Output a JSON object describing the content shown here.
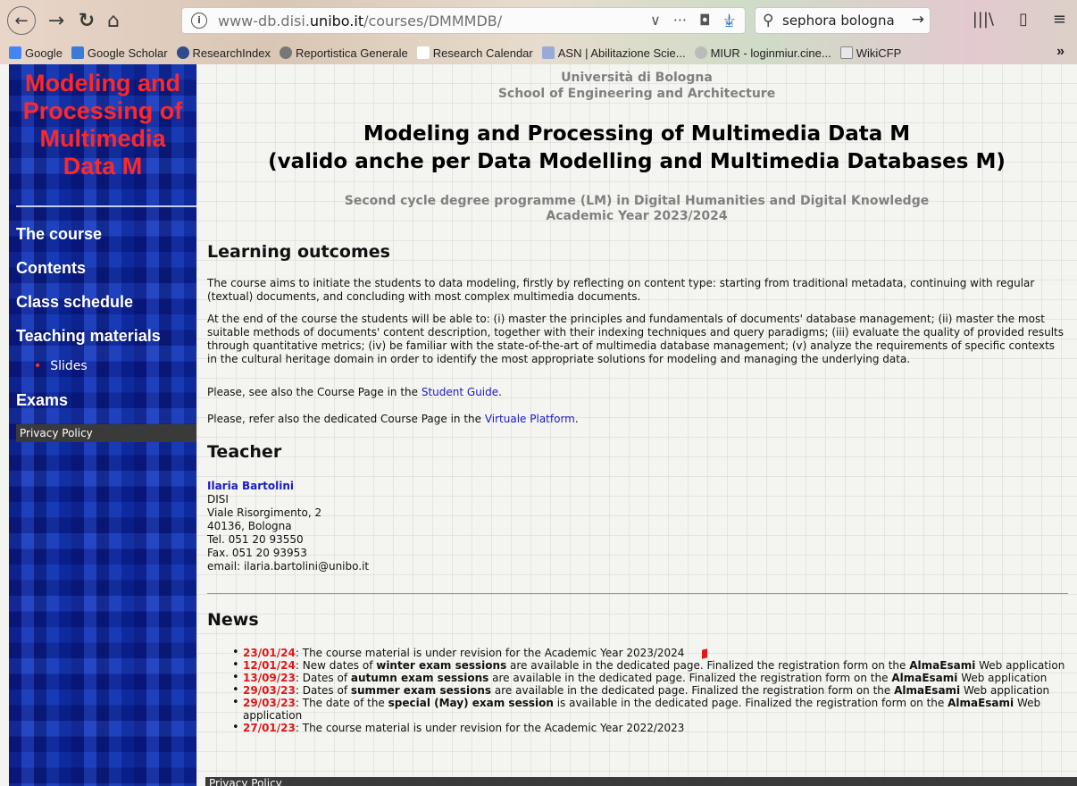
{
  "browser": {
    "url_prefix": "www-db.disi.",
    "url_host": "unibo.it",
    "url_path": "/courses/DMMMDB/",
    "search_query": "sephora bologna f",
    "bookmarks": [
      "Google",
      "Google Scholar",
      "ResearchIndex",
      "Reportistica Generale",
      "Research Calendar",
      "ASN | Abilitazione Scie...",
      "MIUR - loginmiur.cine...",
      "WikiCFP"
    ],
    "bookmark_more": "»"
  },
  "sidebar": {
    "title_lines": [
      "Modeling and",
      "Processing of",
      "Multimedia",
      "Data M"
    ],
    "items": [
      "The course",
      "Contents",
      "Class schedule",
      "Teaching materials",
      "Exams"
    ],
    "subitem": "Slides",
    "privacy": "Privacy Policy"
  },
  "main": {
    "university": "Università di Bologna",
    "school": "School of Engineering and Architecture",
    "title_line1": "Modeling and Processing of Multimedia Data M",
    "title_line2": "(valido anche per Data Modelling and Multimedia Databases M)",
    "programme": "Second cycle degree programme (LM) in Digital Humanities and Digital Knowledge",
    "year": "Academic Year 2023/2024",
    "h_outcomes": "Learning outcomes",
    "outcomes_p1": "The course aims to initiate the students to data modeling, firstly by reflecting on content type: starting from traditional metadata, continuing with regular (textual) documents, and concluding with most complex multimedia documents.",
    "outcomes_p2": "At the end of the course the students will be able to: (i) master the principles and fundamentals of documents' database management; (ii) master the most suitable methods of documents' content description, together with their indexing techniques and query paradigms; (iii) evaluate the quality of provided results through quantitative metrics; (iv) be familiar with the state-of-the-art of multimedia database management; (v) analyze the requirements of specific contexts in the cultural heritage domain in order to identify the most appropriate solutions for modeling and managing the underlying data.",
    "guide_pre": "Please, see also the Course Page in the ",
    "guide_link": "Student Guide",
    "guide_post": ".",
    "platform_pre": "Please, refer also the dedicated Course Page in the ",
    "platform_link": "Virtuale Platform",
    "platform_post": ".",
    "h_teacher": "Teacher",
    "teacher_name": "Ilaria Bartolini",
    "teacher_lines": [
      "DISI",
      "Viale Risorgimento, 2",
      "40136, Bologna",
      "Tel. 051 20 93550",
      "Fax. 051 20 93953",
      "email: ilaria.bartolini@unibo.it"
    ],
    "h_news": "News",
    "footer": "Privacy Policy"
  },
  "news": [
    {
      "date": "23/01/24",
      "parts": [
        ": The course material is under revision for the Academic Year 2023/2024"
      ],
      "flag": true
    },
    {
      "date": "12/01/24",
      "parts": [
        ": New dates of ",
        "winter exam sessions",
        " are available in the dedicated page. Finalized the registration form on the ",
        "AlmaEsami",
        " Web application"
      ]
    },
    {
      "date": "13/09/23",
      "parts": [
        ": Dates of ",
        "autumn exam sessions",
        " are available in the dedicated page. Finalized the registration form on the ",
        "AlmaEsami",
        " Web application"
      ]
    },
    {
      "date": "29/03/23",
      "parts": [
        ": Dates of ",
        "summer exam sessions",
        " are available in the dedicated page. Finalized the registration form on the ",
        "AlmaEsami",
        " Web application"
      ]
    },
    {
      "date": "29/03/23",
      "parts": [
        ": The date of the ",
        "special (May) exam session",
        " is available in the dedicated page. Finalized the registration form on the ",
        "AlmaEsami",
        " Web application"
      ]
    },
    {
      "date": "27/01/23",
      "parts": [
        ": The course material is under revision for the Academic Year 2022/2023"
      ]
    }
  ],
  "colors": {
    "sidebar_bg": "#1230a8",
    "sidebar_title": "#ff2828",
    "news_date": "#e01818",
    "link": "#1a1acc"
  }
}
